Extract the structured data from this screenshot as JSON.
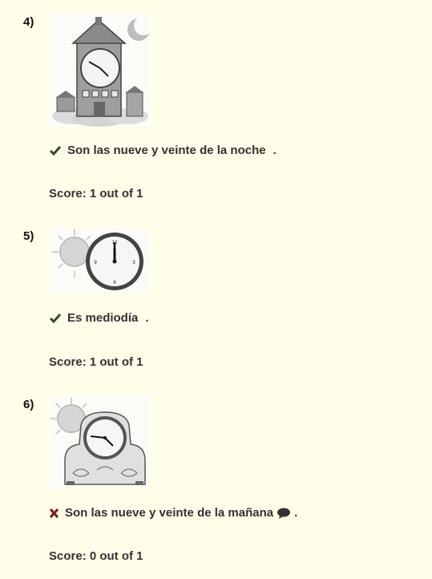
{
  "questions": [
    {
      "number": "4)",
      "answer": "Son las nueve y veinte de la noche",
      "punct": ".",
      "status": "correct",
      "score": "Score: 1 out of 1"
    },
    {
      "number": "5)",
      "answer": "Es mediodía",
      "punct": ".",
      "status": "correct",
      "score": "Score: 1 out of 1"
    },
    {
      "number": "6)",
      "answer": "Son las nueve y veinte de la mañana",
      "punct": ".",
      "status": "incorrect",
      "score": "Score: 0 out of 1"
    }
  ],
  "icons": {
    "correct": "check-icon",
    "incorrect": "cross-icon",
    "comment": "comment-icon"
  },
  "colors": {
    "background": "#fffee8",
    "correct": "#2e4a2e",
    "incorrect": "#7a1a1a"
  }
}
